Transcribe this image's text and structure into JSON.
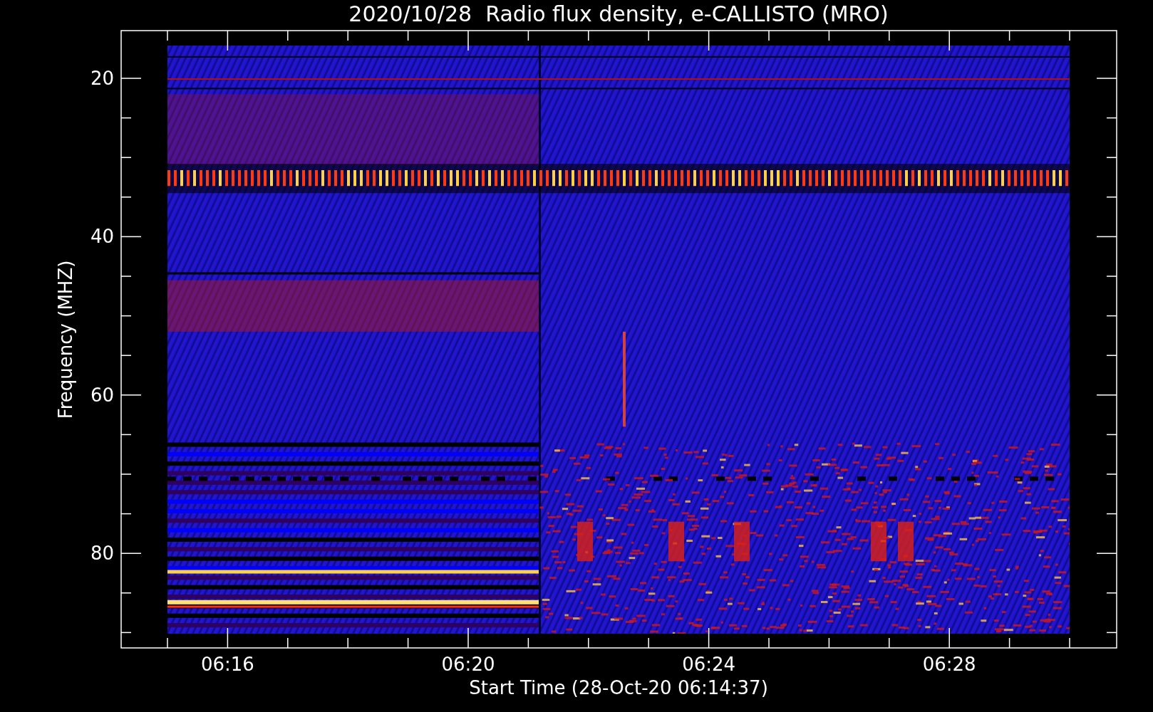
{
  "title": "2020/10/28  Radio flux density, e-CALLISTO (MRO)",
  "y_axis": {
    "label": "Frequency (MHZ)",
    "tick_labels": [
      "20",
      "40",
      "60",
      "80"
    ]
  },
  "x_axis": {
    "label": "Start Time (28-Oct-20 06:14:37)",
    "tick_labels": [
      "06:16",
      "06:20",
      "06:24",
      "06:28"
    ]
  }
}
